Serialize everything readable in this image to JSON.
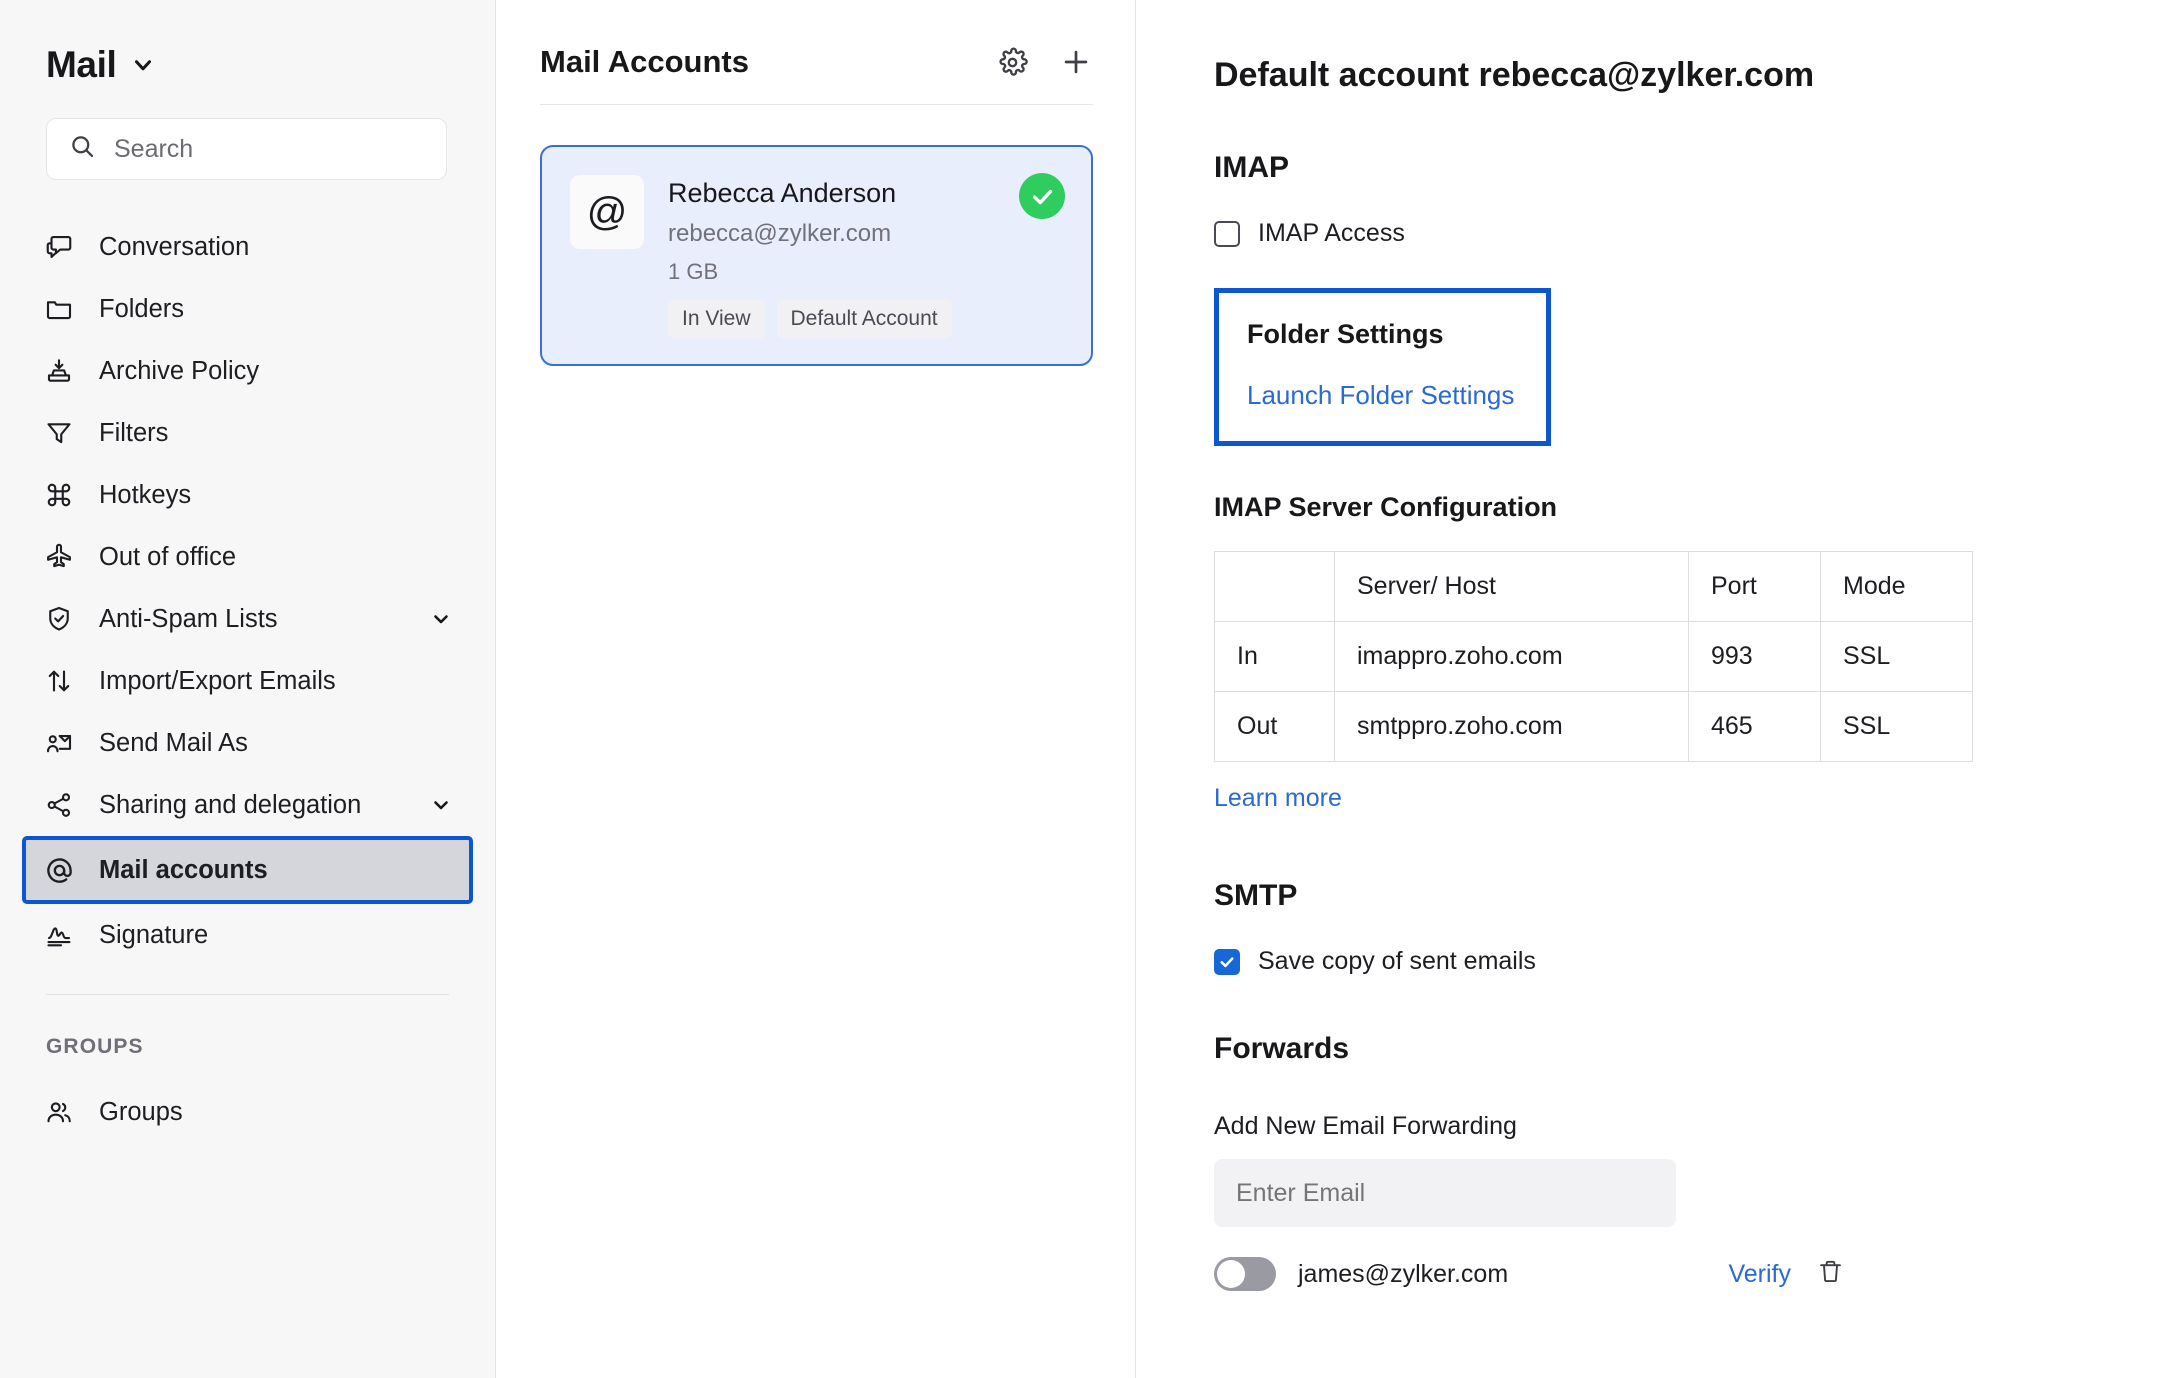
{
  "sidebar": {
    "title": "Mail",
    "chevron_icon": "chevron-down-icon",
    "search": {
      "placeholder": "Search",
      "icon": "search-icon"
    },
    "items": [
      {
        "label": "Conversation",
        "icon": "chat-bubble-icon",
        "chevron": false,
        "active": false
      },
      {
        "label": "Folders",
        "icon": "folder-icon",
        "chevron": false,
        "active": false
      },
      {
        "label": "Archive Policy",
        "icon": "archive-inbox-icon",
        "chevron": false,
        "active": false
      },
      {
        "label": "Filters",
        "icon": "funnel-icon",
        "chevron": false,
        "active": false
      },
      {
        "label": "Hotkeys",
        "icon": "command-key-icon",
        "chevron": false,
        "active": false
      },
      {
        "label": "Out of office",
        "icon": "airplane-icon",
        "chevron": false,
        "active": false
      },
      {
        "label": "Anti-Spam Lists",
        "icon": "shield-check-icon",
        "chevron": true,
        "active": false
      },
      {
        "label": "Import/Export Emails",
        "icon": "arrows-up-down-icon",
        "chevron": false,
        "active": false
      },
      {
        "label": "Send Mail As",
        "icon": "person-envelope-icon",
        "chevron": false,
        "active": false
      },
      {
        "label": "Sharing and delegation",
        "icon": "share-nodes-icon",
        "chevron": true,
        "active": false
      },
      {
        "label": "Mail accounts",
        "icon": "at-sign-icon",
        "chevron": false,
        "active": true
      },
      {
        "label": "Signature",
        "icon": "signature-pen-icon",
        "chevron": false,
        "active": false
      }
    ],
    "groups_header": "GROUPS",
    "groups_items": [
      {
        "label": "Groups",
        "icon": "people-icon",
        "chevron": false,
        "active": false
      }
    ]
  },
  "middle": {
    "title": "Mail Accounts",
    "settings_icon": "gear-icon",
    "add_icon": "plus-icon",
    "account": {
      "avatar_glyph": "@",
      "name": "Rebecca Anderson",
      "email": "rebecca@zylker.com",
      "storage": "1 GB",
      "badges": [
        "In View",
        "Default Account"
      ],
      "status_icon": "check-circle-icon",
      "status_color": "#2fcc5e"
    }
  },
  "right": {
    "page_title": "Default account rebecca@zylker.com",
    "imap": {
      "heading": "IMAP",
      "access_label": "IMAP Access",
      "access_checked": false,
      "folder_settings": {
        "title": "Folder Settings",
        "launch_label": "Launch Folder Settings",
        "highlight_color": "#0b57d0"
      },
      "server_config": {
        "heading": "IMAP Server Configuration",
        "columns": [
          "",
          "Server/ Host",
          "Port",
          "Mode"
        ],
        "rows": [
          [
            "In",
            "imappro.zoho.com",
            "993",
            "SSL"
          ],
          [
            "Out",
            "smtppro.zoho.com",
            "465",
            "SSL"
          ]
        ],
        "learn_more": "Learn more"
      }
    },
    "smtp": {
      "heading": "SMTP",
      "save_copy_label": "Save copy of sent emails",
      "save_copy_checked": true
    },
    "forwards": {
      "heading": "Forwards",
      "add_label": "Add New Email Forwarding",
      "input_placeholder": "Enter Email",
      "input_value": "",
      "existing": {
        "toggle_on": false,
        "address": "james@zylker.com",
        "verify_label": "Verify",
        "delete_icon": "trash-icon"
      }
    }
  }
}
